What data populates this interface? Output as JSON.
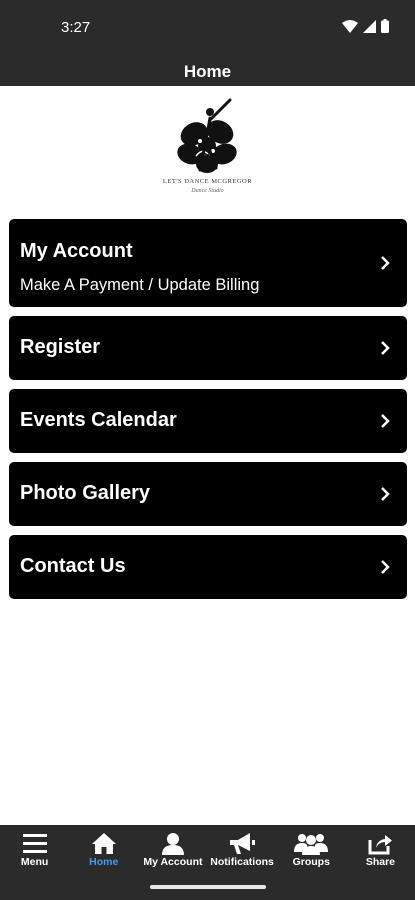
{
  "status_bar": {
    "time": "3:27"
  },
  "header": {
    "title": "Home"
  },
  "logo": {
    "icon": "dancer-hibiscus-logo"
  },
  "menu": {
    "items": [
      {
        "title": "My Account",
        "subtitle": "Make A Payment / Update Billing"
      },
      {
        "title": "Register"
      },
      {
        "title": "Events Calendar"
      },
      {
        "title": "Photo Gallery"
      },
      {
        "title": "Contact Us"
      }
    ]
  },
  "bottom_nav": {
    "items": [
      {
        "label": "Menu",
        "icon": "hamburger-icon"
      },
      {
        "label": "Home",
        "icon": "home-icon",
        "active": true
      },
      {
        "label": "My Account",
        "icon": "person-icon"
      },
      {
        "label": "Notifications",
        "icon": "megaphone-icon"
      },
      {
        "label": "Groups",
        "icon": "group-icon"
      },
      {
        "label": "Share",
        "icon": "share-icon"
      }
    ]
  },
  "colors": {
    "bar_background": "#2b2b2b",
    "card_background": "#000000",
    "active_nav": "#3b9cf0"
  }
}
